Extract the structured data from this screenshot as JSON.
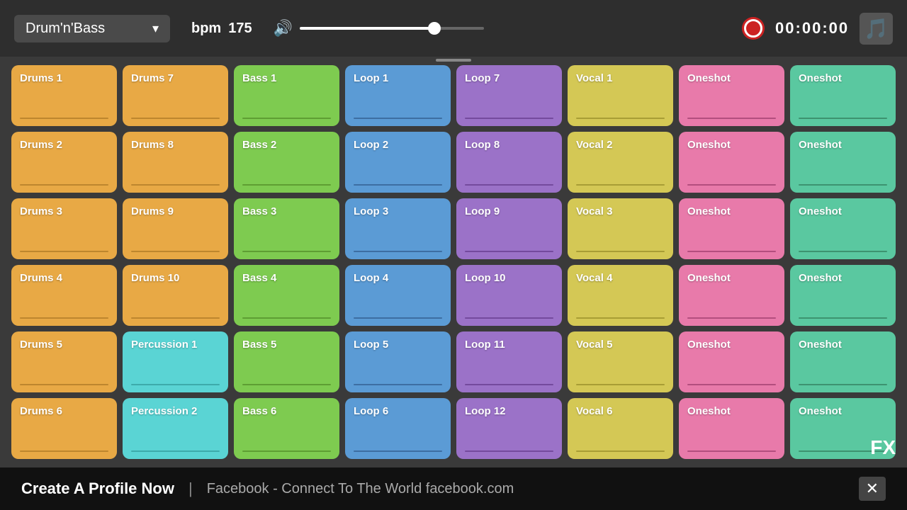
{
  "header": {
    "genre": "Drum'n'Bass",
    "bpm_label": "bpm",
    "bpm_value": "175",
    "volume_pct": 75,
    "timer": "00:00:00",
    "genre_dropdown_icon": "▾",
    "volume_icon": "🔊",
    "music_icon": "🎵"
  },
  "pads": [
    {
      "label": "Drums 1",
      "color": "orange"
    },
    {
      "label": "Drums 7",
      "color": "orange"
    },
    {
      "label": "Bass 1",
      "color": "green"
    },
    {
      "label": "Loop 1",
      "color": "blue"
    },
    {
      "label": "Loop 7",
      "color": "purple"
    },
    {
      "label": "Vocal 1",
      "color": "yellow"
    },
    {
      "label": "Oneshot",
      "color": "pink"
    },
    {
      "label": "Oneshot",
      "color": "teal"
    },
    {
      "label": "Drums 2",
      "color": "orange"
    },
    {
      "label": "Drums 8",
      "color": "orange"
    },
    {
      "label": "Bass 2",
      "color": "green"
    },
    {
      "label": "Loop 2",
      "color": "blue"
    },
    {
      "label": "Loop 8",
      "color": "purple"
    },
    {
      "label": "Vocal 2",
      "color": "yellow"
    },
    {
      "label": "Oneshot",
      "color": "pink"
    },
    {
      "label": "Oneshot",
      "color": "teal"
    },
    {
      "label": "Drums 3",
      "color": "orange"
    },
    {
      "label": "Drums 9",
      "color": "orange"
    },
    {
      "label": "Bass 3",
      "color": "green"
    },
    {
      "label": "Loop 3",
      "color": "blue"
    },
    {
      "label": "Loop 9",
      "color": "purple"
    },
    {
      "label": "Vocal 3",
      "color": "yellow"
    },
    {
      "label": "Oneshot",
      "color": "pink"
    },
    {
      "label": "Oneshot",
      "color": "teal"
    },
    {
      "label": "Drums 4",
      "color": "orange"
    },
    {
      "label": "Drums 10",
      "color": "orange"
    },
    {
      "label": "Bass 4",
      "color": "green"
    },
    {
      "label": "Loop 4",
      "color": "blue"
    },
    {
      "label": "Loop 10",
      "color": "purple"
    },
    {
      "label": "Vocal 4",
      "color": "yellow"
    },
    {
      "label": "Oneshot",
      "color": "pink"
    },
    {
      "label": "Oneshot",
      "color": "teal"
    },
    {
      "label": "Drums 5",
      "color": "orange"
    },
    {
      "label": "Percussion 1",
      "color": "cyan"
    },
    {
      "label": "Bass 5",
      "color": "green"
    },
    {
      "label": "Loop 5",
      "color": "blue"
    },
    {
      "label": "Loop 11",
      "color": "purple"
    },
    {
      "label": "Vocal 5",
      "color": "yellow"
    },
    {
      "label": "Oneshot",
      "color": "pink"
    },
    {
      "label": "Oneshot",
      "color": "teal"
    },
    {
      "label": "Drums 6",
      "color": "orange"
    },
    {
      "label": "Percussion 2",
      "color": "cyan"
    },
    {
      "label": "Bass 6",
      "color": "green"
    },
    {
      "label": "Loop 6",
      "color": "blue"
    },
    {
      "label": "Loop 12",
      "color": "purple"
    },
    {
      "label": "Vocal 6",
      "color": "yellow"
    },
    {
      "label": "Oneshot",
      "color": "pink"
    },
    {
      "label": "Oneshot",
      "color": "teal"
    }
  ],
  "fx_label": "FX",
  "ad": {
    "main": "Create A Profile Now",
    "divider": "|",
    "sub": "Facebook - Connect To The World  facebook.com"
  }
}
